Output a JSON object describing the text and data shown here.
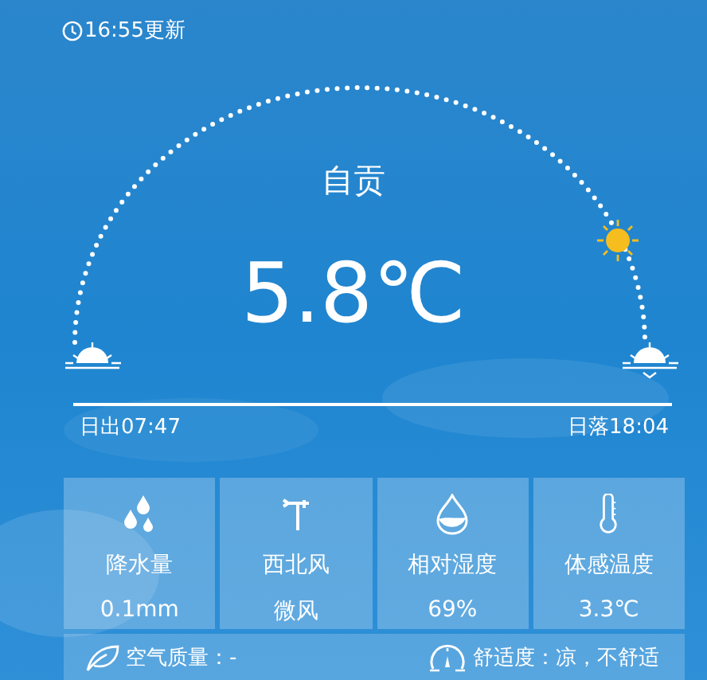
{
  "update_time": "16:55更新",
  "city": "自贡",
  "temperature": "5.8℃",
  "sunrise": "日出07:47",
  "sunset": "日落18:04",
  "stats": [
    {
      "kind": "rain",
      "label": "降水量",
      "value": "0.1mm"
    },
    {
      "kind": "wind",
      "label": "西北风",
      "value": "微风"
    },
    {
      "kind": "humidity",
      "label": "相对湿度",
      "value": "69%"
    },
    {
      "kind": "feels",
      "label": "体感温度",
      "value": "3.3℃"
    }
  ],
  "air_quality": "空气质量：-",
  "comfort": "舒适度：凉，不舒适"
}
